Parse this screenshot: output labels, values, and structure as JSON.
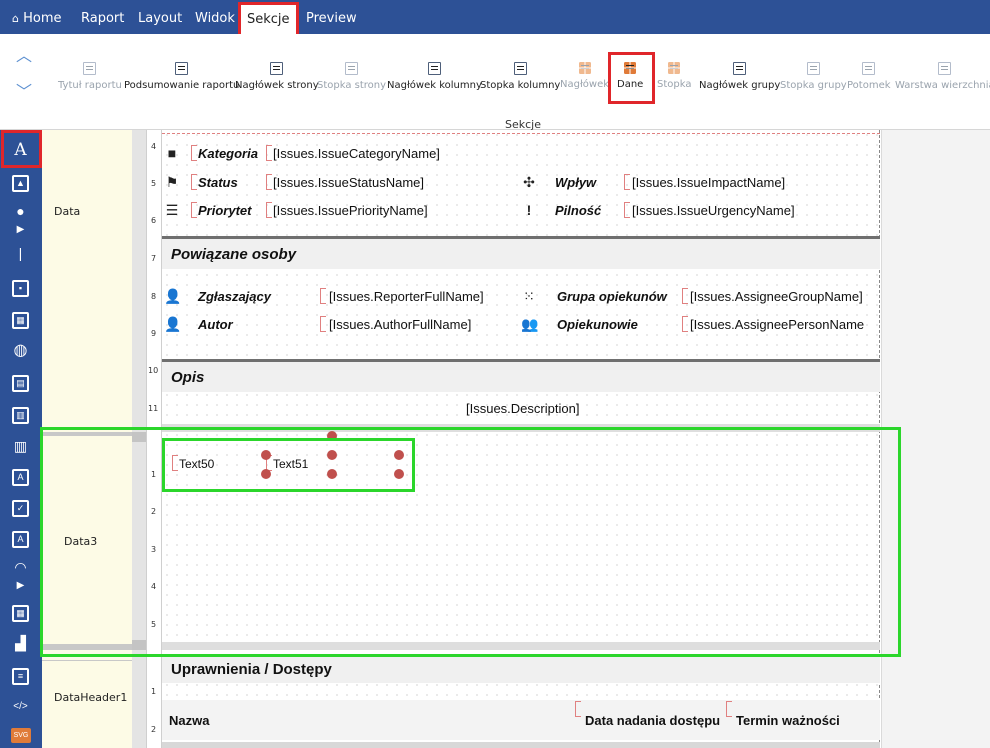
{
  "menu": {
    "home": "Home",
    "raport": "Raport",
    "layout": "Layout",
    "widok": "Widok",
    "sekcje": "Sekcje",
    "preview": "Preview"
  },
  "ribbon": {
    "group_label": "Sekcje",
    "items": [
      {
        "label": "Tytuł raportu",
        "enabled": false
      },
      {
        "label": "Podsumowanie raportu",
        "enabled": true
      },
      {
        "label": "Nagłówek strony",
        "enabled": true
      },
      {
        "label": "Stopka strony",
        "enabled": false
      },
      {
        "label": "Nagłówek kolumny",
        "enabled": true
      },
      {
        "label": "Stopka kolumny",
        "enabled": true
      },
      {
        "label": "Nagłówek",
        "enabled": false
      },
      {
        "label": "Dane",
        "enabled": true
      },
      {
        "label": "Stopka",
        "enabled": false
      },
      {
        "label": "Nagłówek grupy",
        "enabled": true
      },
      {
        "label": "Stopka grupy",
        "enabled": false
      },
      {
        "label": "Potomek",
        "enabled": false
      },
      {
        "label": "Warstwa wierzchnia",
        "enabled": false
      }
    ]
  },
  "bands": {
    "data": "Data",
    "data3": "Data3",
    "dataheader1": "DataHeader1"
  },
  "ruler": {
    "data_rows": [
      "4",
      "5",
      "6",
      "7",
      "8",
      "9",
      "10",
      "11"
    ],
    "data3_rows": [
      "1",
      "2",
      "3",
      "4",
      "5"
    ],
    "header_rows": [
      "1",
      "2"
    ]
  },
  "report": {
    "fields_top": [
      {
        "label": "Kategoria",
        "value": "[Issues.IssueCategoryName]"
      },
      {
        "label": "Status",
        "value": "[Issues.IssueStatusName]"
      },
      {
        "label": "Priorytet",
        "value": "[Issues.IssuePriorityName]"
      }
    ],
    "fields_top_right": [
      {
        "label": "Wpływ",
        "value": "[Issues.IssueImpactName]"
      },
      {
        "label": "Pilność",
        "value": "[Issues.IssueUrgencyName]"
      }
    ],
    "section_people": "Powiązane osoby",
    "people": [
      {
        "label": "Zgłaszający",
        "value": "[Issues.ReporterFullName]"
      },
      {
        "label": "Autor",
        "value": "[Issues.AuthorFullName]"
      }
    ],
    "people_right": [
      {
        "label": "Grupa opiekunów",
        "value": "[Issues.AssigneeGroupName]"
      },
      {
        "label": "Opiekunowie",
        "value": "[Issues.AssigneePersonName"
      }
    ],
    "section_desc": "Opis",
    "description": "[Issues.Description]",
    "text50": "Text50",
    "text51": "Text51",
    "section_perm": "Uprawnienia / Dostępy",
    "col_name": "Nazwa",
    "col_date": "Data nadania dostępu",
    "col_term": "Termin ważności"
  },
  "colors": {
    "topbar": "#2d5196",
    "highlight_red": "#e0262a",
    "highlight_green": "#2bd62b",
    "handle": "#c0504d"
  }
}
